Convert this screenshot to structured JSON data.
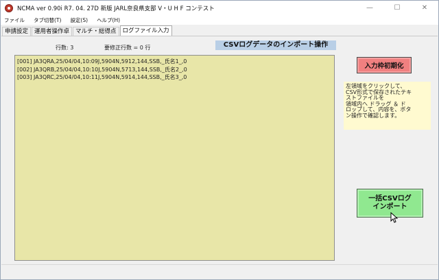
{
  "window": {
    "title": "NCMA ver 0.90i   R7. 04. 27D 新版 JARL奈良県支部 V・U H F コンテスト",
    "minimize_label": "—",
    "maximize_label": "☐",
    "close_label": "✕"
  },
  "menu": [
    {
      "label": "ファイル"
    },
    {
      "label": "タブ切替(T)"
    },
    {
      "label": "設定(S)"
    },
    {
      "label": "ヘルプ(H)"
    }
  ],
  "tabs": [
    {
      "label": "申請設定",
      "active": false
    },
    {
      "label": "運用者操作卓",
      "active": false
    },
    {
      "label": "マルチ・総得点",
      "active": false
    },
    {
      "label": "ログファイル入力",
      "active": true
    }
  ],
  "panel": {
    "row_count_label": "行数: 3",
    "fix_count_label": "要修正行数 = 0 行",
    "import_title": "CSVログデータのインポート操作",
    "log_lines": [
      {
        "text": "[001] JA3QRA,25/04/04,10:09J,5904N,5912,144,SSB,_氏名1_,0"
      },
      {
        "text": "[002] JA3QRB,25/04/04,10:10J,5904N,5713,144,SSB,_氏名2_,0"
      },
      {
        "text": "[003] JA3QRC,25/04/04,10:11J,5904N,5914,144,SSB,_氏名3_,0"
      }
    ],
    "reset_button": "入力枠初期化",
    "help_lines": [
      "  左領域をクリックして、",
      "CSV形式で保存されたテキ",
      "ストファイルを",
      "領域内へ ドラッグ ＆ ド",
      "ロップして、内容を、ボタ",
      "ン操作で確認します。"
    ],
    "bulk_button_line1": "一括CSVログ",
    "bulk_button_line2": "インポート"
  },
  "colors": {
    "drop_area": "#e8e6a8",
    "reset_button": "#f08080",
    "bulk_button": "#90e890",
    "help_box": "#fffad0",
    "title_highlight": "#b9cfe6"
  }
}
